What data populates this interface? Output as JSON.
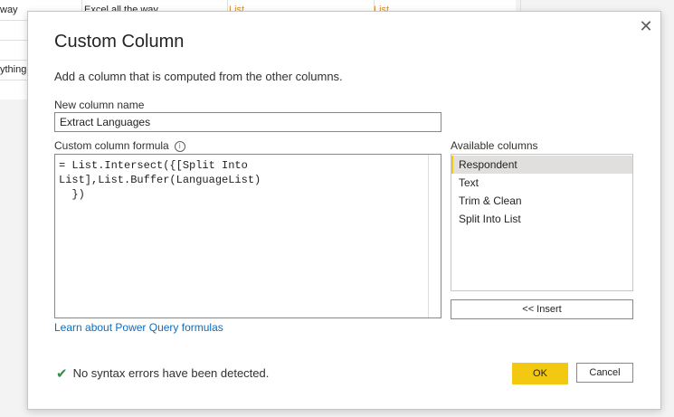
{
  "background": {
    "rows": [
      {
        "c1": "way",
        "c2": "Excel all the way",
        "c3": "List",
        "c4": "List"
      },
      {
        "c1": "",
        "c2": "",
        "c3": "",
        "c4": ""
      },
      {
        "c1": "",
        "c2": "",
        "c3": "",
        "c4": ""
      },
      {
        "c1": "ything",
        "c2": "",
        "c3": "",
        "c4": ""
      }
    ]
  },
  "dialog": {
    "title": "Custom Column",
    "description": "Add a column that is computed from the other columns.",
    "close_glyph": "✕",
    "new_column_name_label": "New column name",
    "new_column_name_value": "Extract Languages",
    "formula_label": "Custom column formula",
    "info_glyph": "i",
    "formula_text": "= List.Intersect({[Split Into List],List.Buffer(LanguageList)\n  })",
    "available_columns_label": "Available columns",
    "available_columns": [
      "Respondent",
      "Text",
      "Trim & Clean",
      "Split Into List"
    ],
    "selected_column": "Respondent",
    "insert_label": "<< Insert",
    "learn_link": "Learn about Power Query formulas",
    "status_glyph": "✔",
    "status_text": "No syntax errors have been detected.",
    "ok_label": "OK",
    "cancel_label": "Cancel"
  },
  "colors": {
    "accent": "#f2c811",
    "link": "#0f6cbd",
    "success": "#2f8f46",
    "list_text": "#d58d2e"
  }
}
